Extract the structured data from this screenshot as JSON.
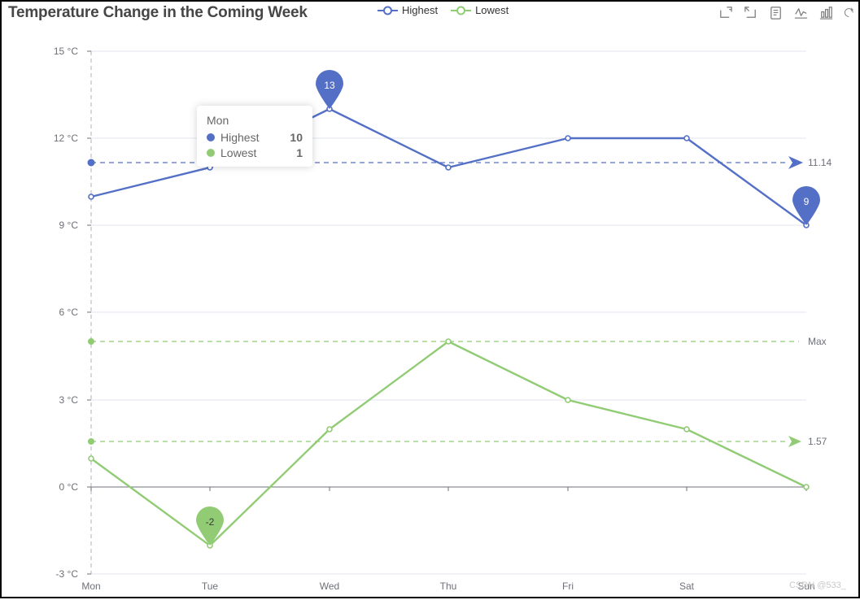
{
  "header": {
    "title": "Temperature Change in the Coming Week"
  },
  "legend": {
    "items": [
      {
        "label": "Highest",
        "color": "#5470c6"
      },
      {
        "label": "Lowest",
        "color": "#91cc75"
      }
    ]
  },
  "toolbox": {
    "items": [
      {
        "name": "data-zoom-icon",
        "title": "Data Zoom"
      },
      {
        "name": "restore-zoom-icon",
        "title": "Restore Zoom"
      },
      {
        "name": "data-view-icon",
        "title": "Data View"
      },
      {
        "name": "line-chart-icon",
        "title": "Switch to Line Chart"
      },
      {
        "name": "bar-chart-icon",
        "title": "Switch to Bar Chart"
      },
      {
        "name": "restore-icon",
        "title": "Restore"
      }
    ]
  },
  "tooltip": {
    "title": "Mon",
    "rows": [
      {
        "name": "Highest",
        "value": "10",
        "color": "#5470c6"
      },
      {
        "name": "Lowest",
        "value": "1",
        "color": "#91cc75"
      }
    ]
  },
  "watermark": "CSDN @533_",
  "chart_data": {
    "type": "line",
    "title": "Temperature Change in the Coming Week",
    "xlabel": "",
    "ylabel": "",
    "categories": [
      "Mon",
      "Tue",
      "Wed",
      "Thu",
      "Fri",
      "Sat",
      "Sun"
    ],
    "ylim": [
      -3,
      15
    ],
    "yticks": [
      "-3 °C",
      "0 °C",
      "3 °C",
      "6 °C",
      "9 °C",
      "12 °C",
      "15 °C"
    ],
    "ytick_values": [
      -3,
      0,
      3,
      6,
      9,
      12,
      15
    ],
    "grid": true,
    "legend_position": "top-center",
    "axis_unit": "°C",
    "series": [
      {
        "name": "Highest",
        "color": "#5470c6",
        "values": [
          10,
          11,
          13,
          11,
          12,
          12,
          9
        ],
        "mark_points": [
          {
            "type": "max",
            "label": "13",
            "category": "Wed",
            "value": 13
          },
          {
            "type": "min",
            "label": "9",
            "category": "Sun",
            "value": 9
          }
        ],
        "mark_lines": [
          {
            "type": "average",
            "label": "11.14",
            "value": 11.14
          }
        ]
      },
      {
        "name": "Lowest",
        "color": "#91cc75",
        "values": [
          1,
          -2,
          2,
          5,
          3,
          2,
          0
        ],
        "mark_points": [
          {
            "type": "min",
            "label": "-2",
            "category": "Tue",
            "value": -2
          }
        ],
        "mark_lines": [
          {
            "type": "average",
            "label": "1.57",
            "value": 1.57
          },
          {
            "type": "max",
            "label": "Max",
            "value": 5
          }
        ]
      }
    ]
  }
}
